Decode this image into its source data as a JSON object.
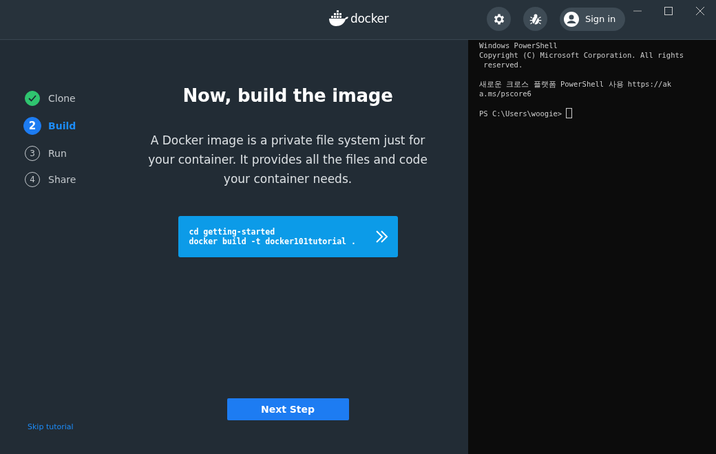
{
  "header": {
    "logo": "docker",
    "sign_in": "Sign in"
  },
  "steps": [
    {
      "label": "Clone",
      "done": true,
      "selected": false
    },
    {
      "number": "2",
      "label": "Build",
      "done": false,
      "selected": true
    },
    {
      "number": "3",
      "label": "Run",
      "done": false,
      "selected": false
    },
    {
      "number": "4",
      "label": "Share",
      "done": false,
      "selected": false
    }
  ],
  "title": "Now, build the image",
  "description": "A Docker image is a private file system just for your container. It provides all the files and code your container needs.",
  "command": [
    "cd getting-started",
    "docker build -t docker101tutorial ."
  ],
  "next_button": "Next Step",
  "skip_link": "Skip tutorial",
  "terminal": {
    "blocks": [
      [
        "Windows PowerShell",
        "Copyright (C) Microsoft Corporation. All rights",
        " reserved."
      ],
      [
        "새로운 크로스 플랫폼 PowerShell 사용 https://ak",
        "a.ms/pscore6"
      ]
    ],
    "prompt": "PS C:\\Users\\woogie>"
  }
}
